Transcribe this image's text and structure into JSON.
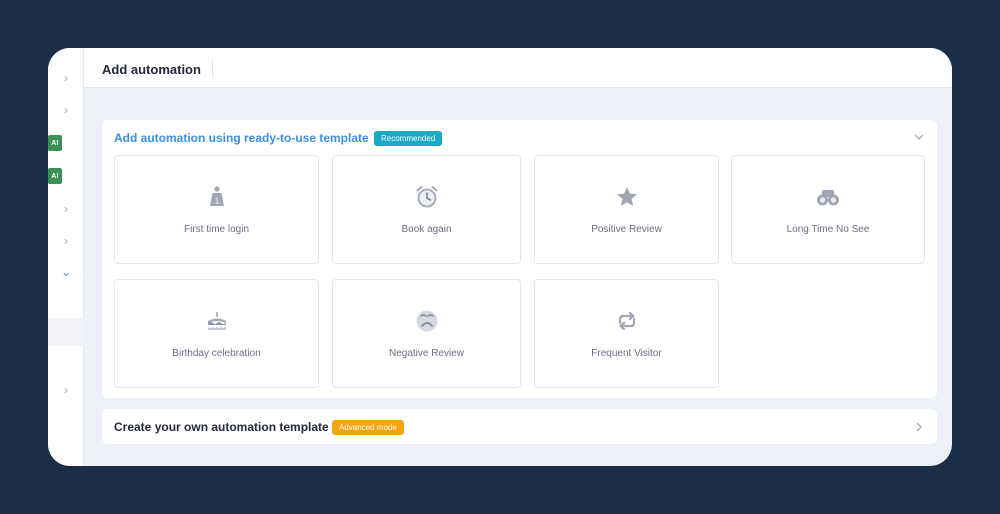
{
  "header": {
    "title": "Add automation"
  },
  "templates": {
    "title": "Add automation using ready-to-use template",
    "badge": "Recommended",
    "cards": [
      {
        "label": "First time login",
        "icon": "podium-icon"
      },
      {
        "label": "Book again",
        "icon": "alarm-clock-icon"
      },
      {
        "label": "Positive Review",
        "icon": "star-icon"
      },
      {
        "label": "Long Time No See",
        "icon": "binoculars-icon"
      },
      {
        "label": "Birthday celebration",
        "icon": "birthday-cake-icon"
      },
      {
        "label": "Negative Review",
        "icon": "sad-face-icon"
      },
      {
        "label": "Frequent Visitor",
        "icon": "repeat-icon"
      }
    ]
  },
  "custom": {
    "title": "Create your own automation template",
    "badge": "Advanced mode"
  },
  "sidebar": {
    "ai_label": "AI"
  },
  "colors": {
    "accent": "#3d8fe0",
    "recommended": "#1aa9c7",
    "advanced": "#f5a40c",
    "background": "#1a2e48"
  }
}
